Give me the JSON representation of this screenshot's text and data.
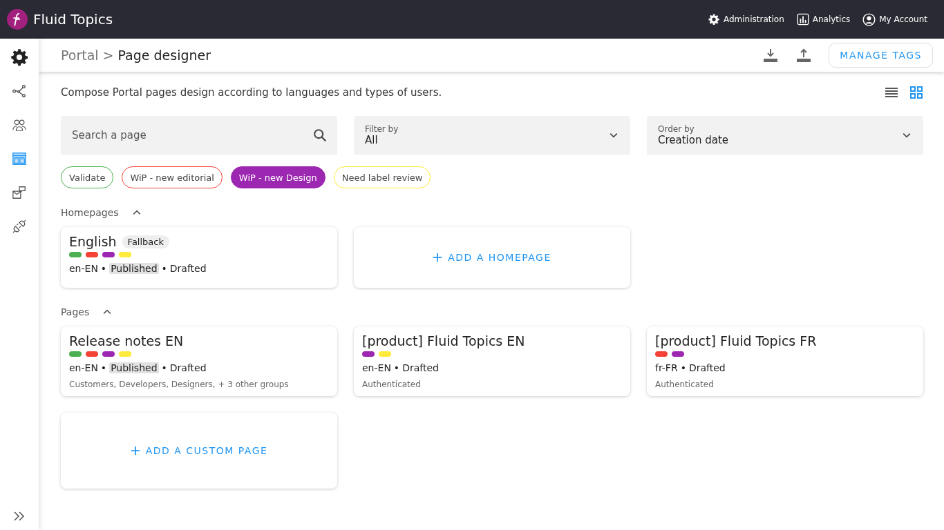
{
  "app": {
    "name": "Fluid Topics"
  },
  "top_nav": [
    {
      "label": "Administration"
    },
    {
      "label": "Analytics"
    },
    {
      "label": "My Account"
    }
  ],
  "sidebar": {
    "items": [
      {
        "selected": false
      },
      {
        "selected": false
      },
      {
        "selected": false
      },
      {
        "selected": true
      },
      {
        "selected": false
      },
      {
        "selected": false
      }
    ]
  },
  "breadcrumb": {
    "parent": "Portal",
    "separator": ">",
    "current": "Page designer"
  },
  "header_actions": {
    "button": "MANAGE TAGS"
  },
  "description": "Compose Portal pages design according to languages and types of users.",
  "views": [
    {
      "selected": false
    },
    {
      "selected": true
    }
  ],
  "search": {
    "placeholder": "Search a page"
  },
  "filter": {
    "label": "Filter by",
    "value": "All"
  },
  "order": {
    "label": "Order by",
    "value": "Creation date"
  },
  "tags": [
    {
      "label": "Validate",
      "color": "#4caf50",
      "selected": false
    },
    {
      "label": "WiP - new editorial",
      "color": "#f44336",
      "selected": false
    },
    {
      "label": "WiP - new Design",
      "color": "#9c27b0",
      "selected": true
    },
    {
      "label": "Need label review",
      "color": "#ffeb3b",
      "selected": false
    }
  ],
  "sections": [
    {
      "title": "Homepages",
      "expanded": true,
      "cards": [
        {
          "kind": "page",
          "title": "English",
          "badge": "Fallback",
          "tags": [
            {
              "color": "#4caf50"
            },
            {
              "color": "#f44336"
            },
            {
              "color": "#9c27b0"
            },
            {
              "color": "#ffeb3b"
            }
          ],
          "status": [
            {
              "text": "en-EN",
              "highlighted": false
            },
            {
              "text": "•",
              "highlighted": false
            },
            {
              "text": "Published",
              "highlighted": true
            },
            {
              "text": "•",
              "highlighted": false
            },
            {
              "text": "Drafted",
              "highlighted": false
            }
          ]
        },
        {
          "kind": "add",
          "label": "ADD A HOMEPAGE"
        }
      ]
    },
    {
      "title": "Pages",
      "expanded": true,
      "cards": [
        {
          "kind": "page",
          "title": "Release notes EN",
          "tags": [
            {
              "color": "#4caf50"
            },
            {
              "color": "#f44336"
            },
            {
              "color": "#9c27b0"
            },
            {
              "color": "#ffeb3b"
            }
          ],
          "status": [
            {
              "text": "en-EN",
              "highlighted": false
            },
            {
              "text": "•",
              "highlighted": false
            },
            {
              "text": "Published",
              "highlighted": true
            },
            {
              "text": "•",
              "highlighted": false
            },
            {
              "text": "Drafted",
              "highlighted": false
            }
          ],
          "groups": "Customers, Developers, Designers, + 3 other groups"
        },
        {
          "kind": "page",
          "title": "[product] Fluid Topics EN",
          "tags": [
            {
              "color": "#9c27b0"
            },
            {
              "color": "#ffeb3b"
            }
          ],
          "status": [
            {
              "text": "en-EN",
              "highlighted": false
            },
            {
              "text": "•",
              "highlighted": false
            },
            {
              "text": "Drafted",
              "highlighted": false
            }
          ],
          "groups": "Authenticated"
        },
        {
          "kind": "page",
          "title": "[product] Fluid Topics FR",
          "tags": [
            {
              "color": "#f44336"
            },
            {
              "color": "#9c27b0"
            }
          ],
          "status": [
            {
              "text": "fr-FR",
              "highlighted": false
            },
            {
              "text": "•",
              "highlighted": false
            },
            {
              "text": "Drafted",
              "highlighted": false
            }
          ],
          "groups": "Authenticated"
        },
        {
          "kind": "add",
          "label": "ADD A CUSTOM PAGE"
        }
      ]
    }
  ]
}
